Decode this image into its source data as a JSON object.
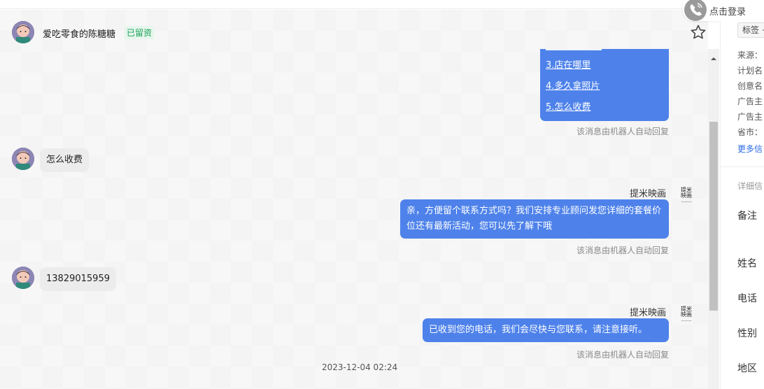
{
  "header": {
    "contact_name": "爱吃零食的陈糖糖",
    "status_badge": "已留资",
    "star": "star-icon"
  },
  "login": {
    "label": "点击登录",
    "icon": "phone-icon"
  },
  "messages": {
    "menu_links": [
      "3.店在哪里",
      "4.多久拿照片",
      "5.怎么收费"
    ],
    "auto_note": "该消息由机器人自动回复",
    "incoming_1": "怎么收费",
    "sender_name": "提米映画",
    "outgoing_1": "亲，方便留个联系方式吗？我们安排专业顾问发您详细的套餐价位还有最新活动，您可以先了解下哦",
    "incoming_2": "13829015959",
    "outgoing_2": "已收到您的电话，我们会尽快与您联系，请注意接听。",
    "logo_text": "提米映画",
    "timestamp": "2023-12-04 02:24"
  },
  "sidebar": {
    "tag_button": "标签 +",
    "info_lines": [
      "来源：",
      "计划名",
      "创意名",
      "广告主",
      "广告主",
      "省市："
    ],
    "more_link": "更多信",
    "section": "详细信",
    "fields": [
      "备注",
      "姓名",
      "电话",
      "性别",
      "地区"
    ]
  },
  "colors": {
    "accent": "#4e82ea",
    "badge": "#18a058",
    "link": "#2f6ce6"
  }
}
